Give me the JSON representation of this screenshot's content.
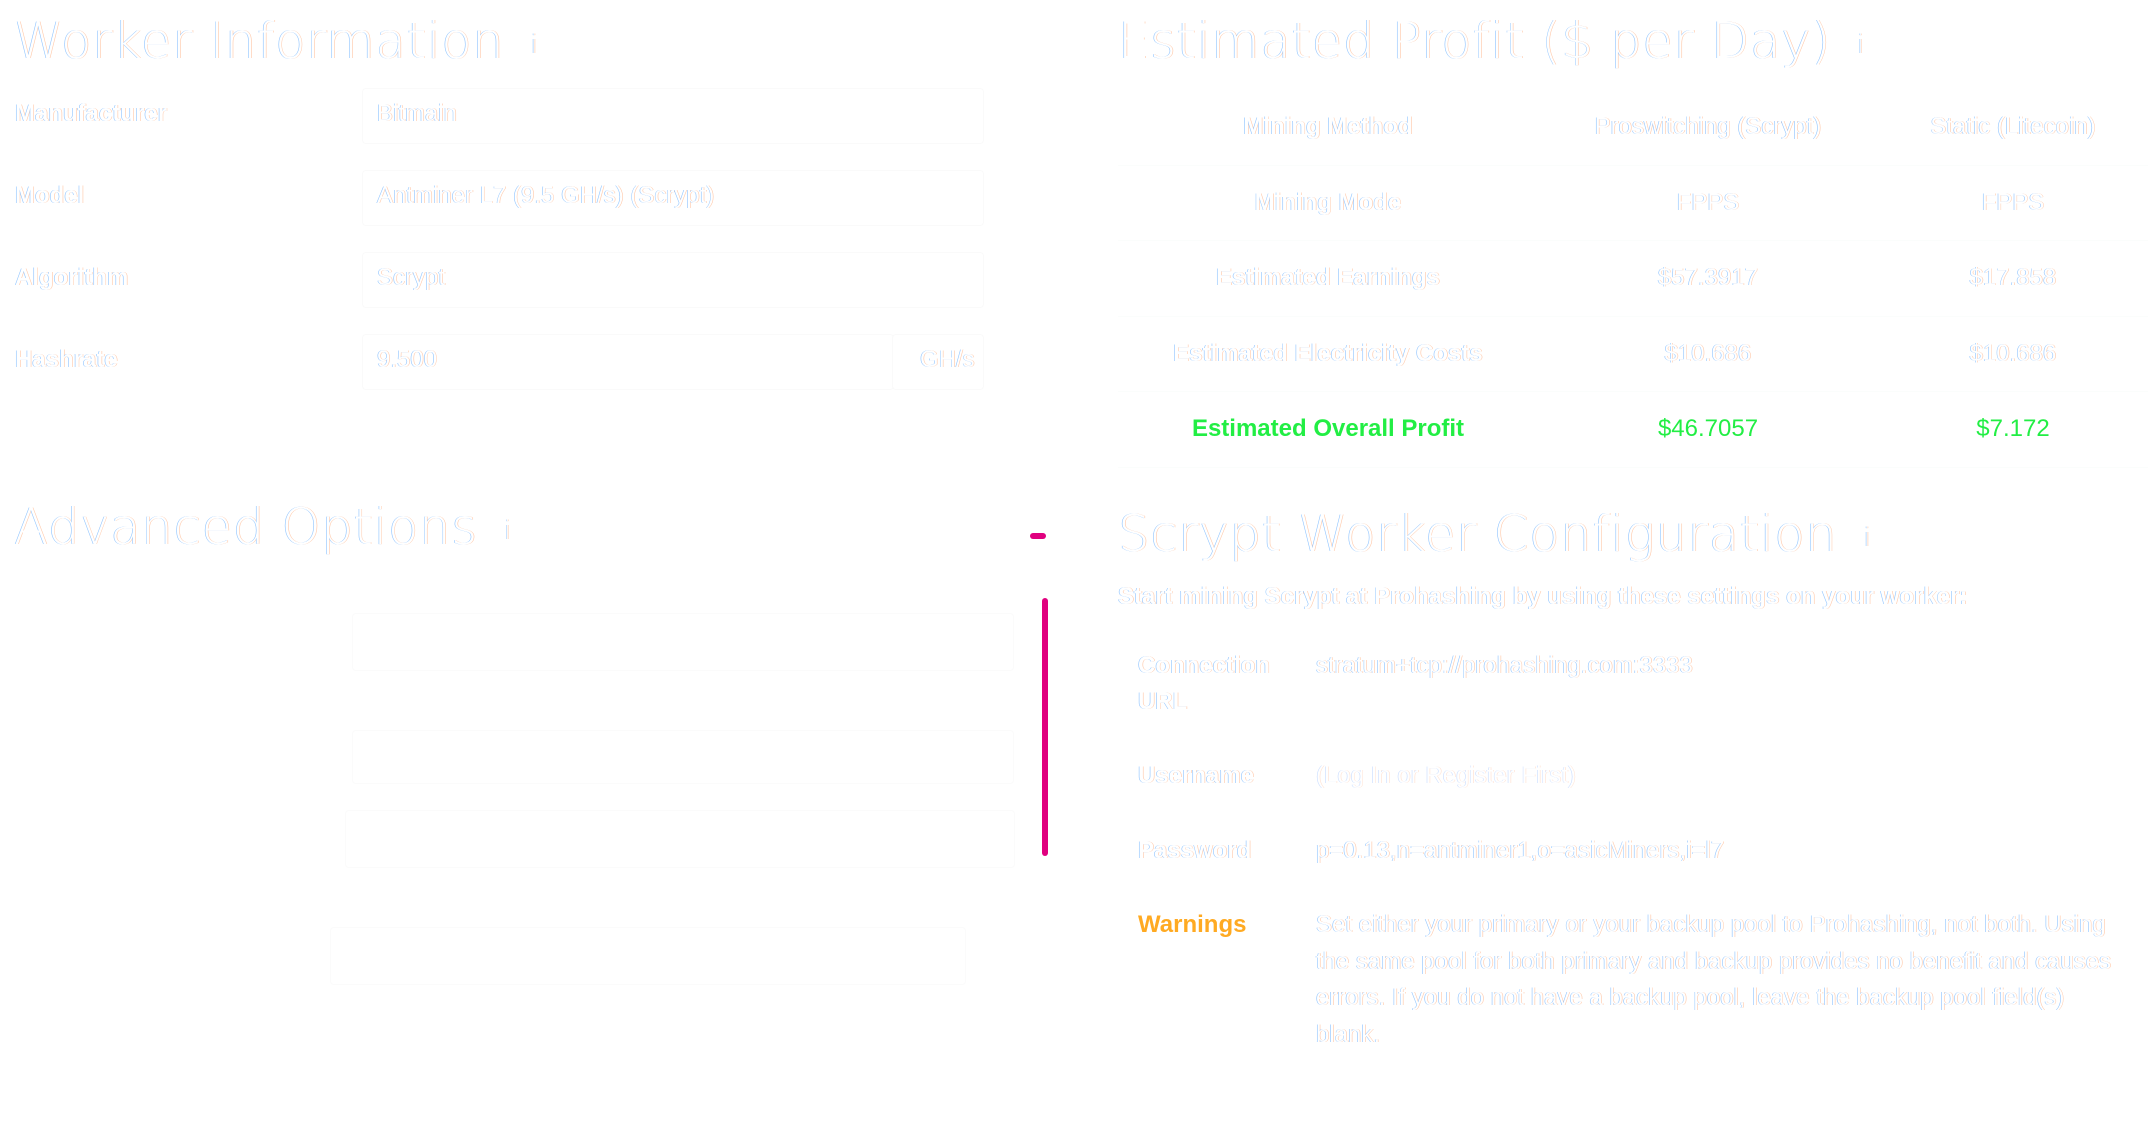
{
  "worker_info": {
    "title": "Worker Information",
    "info_icon": "i",
    "fields": [
      {
        "label": "Manufacturer",
        "value": "Bitmain"
      },
      {
        "label": "Model",
        "value": "Antminer L7 (9.5 GH/s) (Scrypt)"
      },
      {
        "label": "Algorithm",
        "value": "Scrypt"
      },
      {
        "label": "Hashrate",
        "value": "9.500",
        "unit": "GH/s"
      }
    ]
  },
  "profit": {
    "title": "Estimated Profit ($ per Day)",
    "info_icon": "i",
    "rows": [
      {
        "label": "Mining Method",
        "col1": "Proswitching (Scrypt)",
        "col2": "Static (Litecoin)"
      },
      {
        "label": "Mining Mode",
        "col1": "FPPS",
        "col2": "FPPS"
      },
      {
        "label": "Estimated Earnings",
        "col1": "$57.3917",
        "col2": "$17.858"
      },
      {
        "label": "Estimated Electricity Costs",
        "col1": "$10.686",
        "col2": "$10.686"
      },
      {
        "label": "Estimated Overall Profit",
        "col1": "$46.7057",
        "col2": "$7.172"
      }
    ],
    "profit_color": "#22ee44"
  },
  "advanced": {
    "title": "Advanced Options",
    "info_icon": "i",
    "collapse_indicator": "-",
    "accent_color": "#e0007f"
  },
  "config": {
    "title": "Scrypt Worker Configuration",
    "info_icon": "i",
    "subtitle": "Start mining Scrypt at Prohashing by using these settings on your worker:",
    "rows": [
      {
        "label": "Connection URL",
        "value": "stratum+tcp://prohashing.com:3333"
      },
      {
        "label": "Username",
        "value": "(Log In or Register First)"
      },
      {
        "label": "Password",
        "value": "p=0.13,n=antminer1,o=asicMiners,i=l7"
      }
    ],
    "warnings": {
      "label": "Warnings",
      "text": "Set either your primary or your backup pool to Prohashing, not both. Using the same pool for both primary and backup provides no benefit and causes errors. If you do not have a backup pool, leave the backup pool field(s) blank.",
      "color": "#ffaa22"
    }
  }
}
